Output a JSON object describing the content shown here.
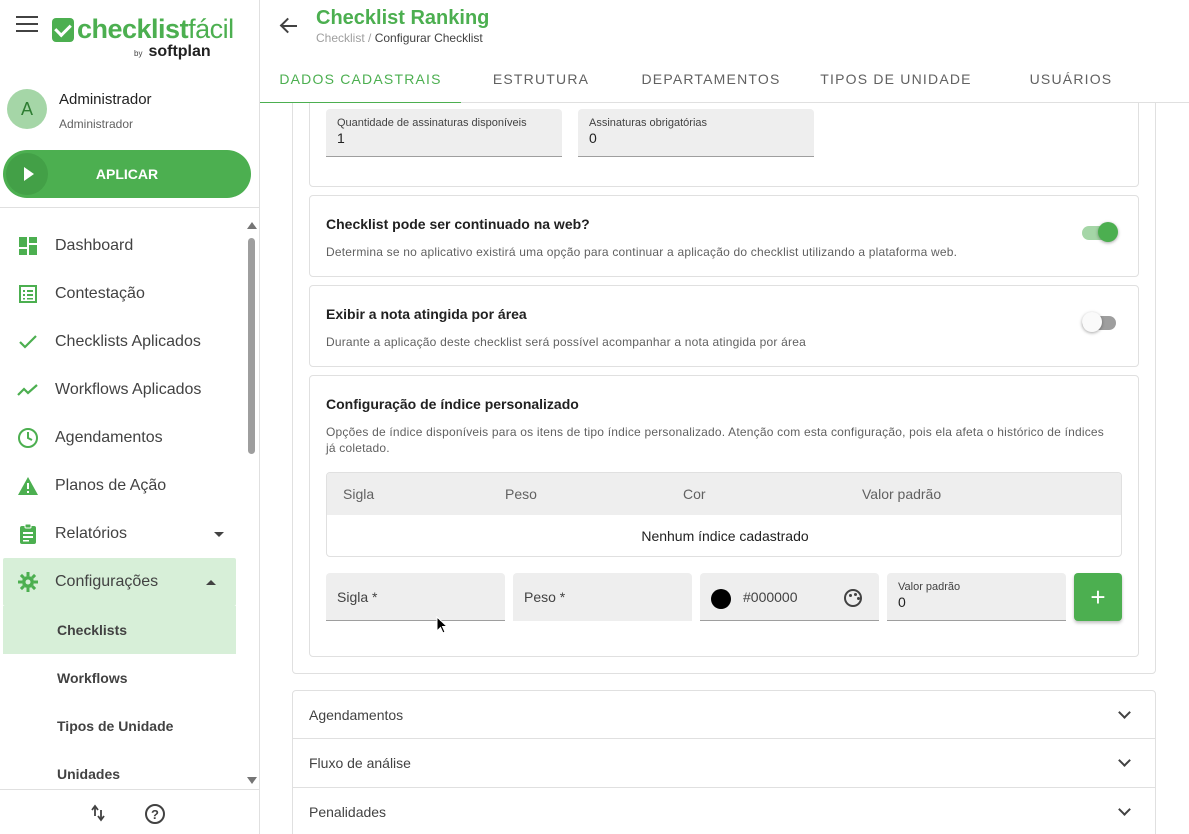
{
  "app": {
    "logo_text_main": "checklist",
    "logo_text_accent": "fácil",
    "logo_by": "by",
    "logo_partner": "softplan"
  },
  "user": {
    "initial": "A",
    "name": "Administrador",
    "role": "Administrador"
  },
  "apply_button": {
    "label": "APLICAR"
  },
  "nav": {
    "items": [
      {
        "label": "Dashboard",
        "icon": "dashboard-icon"
      },
      {
        "label": "Contestação",
        "icon": "list-icon"
      },
      {
        "label": "Checklists Aplicados",
        "icon": "check-icon"
      },
      {
        "label": "Workflows Aplicados",
        "icon": "trending-icon"
      },
      {
        "label": "Agendamentos",
        "icon": "clock-icon"
      },
      {
        "label": "Planos de Ação",
        "icon": "warning-icon"
      },
      {
        "label": "Relatórios",
        "icon": "clipboard-icon"
      },
      {
        "label": "Configurações",
        "icon": "gear-icon"
      }
    ],
    "sub_items": [
      {
        "label": "Checklists"
      },
      {
        "label": "Workflows"
      },
      {
        "label": "Tipos de Unidade"
      },
      {
        "label": "Unidades"
      }
    ]
  },
  "header": {
    "title": "Checklist Ranking",
    "breadcrumb_parent": "Checklist",
    "breadcrumb_sep": " / ",
    "breadcrumb_current": "Configurar Checklist"
  },
  "tabs": [
    {
      "label": "DADOS CADASTRAIS",
      "active": true
    },
    {
      "label": "ESTRUTURA"
    },
    {
      "label": "DEPARTAMENTOS"
    },
    {
      "label": "TIPOS DE UNIDADE"
    },
    {
      "label": "USUÁRIOS"
    }
  ],
  "signatures": {
    "available_label": "Quantidade de assinaturas disponíveis",
    "available_value": "1",
    "required_label": "Assinaturas obrigatórias",
    "required_value": "0"
  },
  "web_continue": {
    "title": "Checklist pode ser continuado na web?",
    "description": "Determina se no aplicativo existirá uma opção para continuar a aplicação do checklist utilizando a plataforma web.",
    "enabled": true
  },
  "area_score": {
    "title": "Exibir a nota atingida por área",
    "description": "Durante a aplicação deste checklist será possível acompanhar a nota atingida por área",
    "enabled": false
  },
  "custom_index": {
    "title": "Configuração de índice personalizado",
    "description": "Opções de índice disponíveis para os itens de tipo índice personalizado. Atenção com esta configuração, pois ela afeta o histórico de índices já coletado.",
    "columns": [
      "Sigla",
      "Peso",
      "Cor",
      "Valor padrão"
    ],
    "empty_text": "Nenhum índice cadastrado",
    "sigla_placeholder": "Sigla *",
    "peso_placeholder": "Peso *",
    "color_value": "#000000",
    "default_label": "Valor padrão",
    "default_value": "0",
    "add_label": "+"
  },
  "panels": [
    {
      "title": "Agendamentos"
    },
    {
      "title": "Fluxo de análise"
    },
    {
      "title": "Penalidades"
    }
  ],
  "footer": {
    "help_label": "?",
    "sort_label": "⇅"
  },
  "colors": {
    "accent": "#4caf50",
    "accent_light": "#d7efd8"
  }
}
